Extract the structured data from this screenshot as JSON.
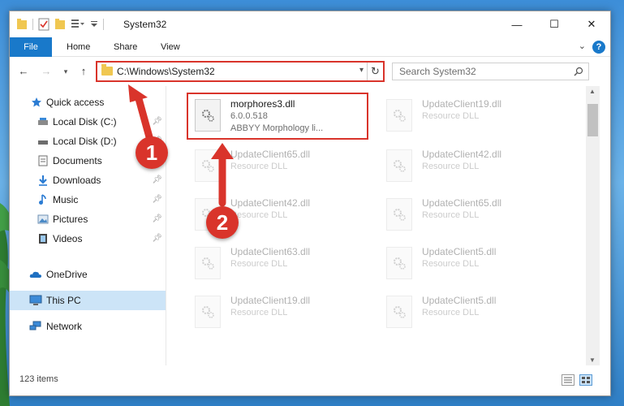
{
  "window": {
    "title": "System32",
    "controls": {
      "minimize": "—",
      "maximize": "☐",
      "close": "✕"
    }
  },
  "ribbon": {
    "tabs": [
      "File",
      "Home",
      "Share",
      "View"
    ],
    "help": "?"
  },
  "navigation": {
    "address": "C:\\Windows\\System32",
    "search_placeholder": "Search System32"
  },
  "sidebar": {
    "items": [
      {
        "label": "Quick access",
        "icon": "star-icon",
        "pinned": false
      },
      {
        "label": "Local Disk (C:)",
        "icon": "drive-icon",
        "pinned": true
      },
      {
        "label": "Local Disk (D:)",
        "icon": "drive-icon",
        "pinned": true
      },
      {
        "label": "Documents",
        "icon": "documents-icon",
        "pinned": true
      },
      {
        "label": "Downloads",
        "icon": "download-icon",
        "pinned": true
      },
      {
        "label": "Music",
        "icon": "music-icon",
        "pinned": true
      },
      {
        "label": "Pictures",
        "icon": "pictures-icon",
        "pinned": true
      },
      {
        "label": "Videos",
        "icon": "videos-icon",
        "pinned": true
      },
      {
        "label": "OneDrive",
        "icon": "cloud-icon",
        "pinned": false
      },
      {
        "label": "This PC",
        "icon": "computer-icon",
        "pinned": false
      },
      {
        "label": "Network",
        "icon": "network-icon",
        "pinned": false
      }
    ]
  },
  "files": [
    {
      "name": "morphores3.dll",
      "line2": "6.0.0.518",
      "line3": "ABBYY Morphology li...",
      "highlighted": true
    },
    {
      "name": "UpdateClient19.dll",
      "line2": "Resource DLL",
      "line3": ""
    },
    {
      "name": "UpdateClient65.dll",
      "line2": "Resource DLL",
      "line3": ""
    },
    {
      "name": "UpdateClient42.dll",
      "line2": "Resource DLL",
      "line3": ""
    },
    {
      "name": "UpdateClient42.dll",
      "line2": "Resource DLL",
      "line3": ""
    },
    {
      "name": "UpdateClient65.dll",
      "line2": "Resource DLL",
      "line3": ""
    },
    {
      "name": "UpdateClient63.dll",
      "line2": "Resource DLL",
      "line3": ""
    },
    {
      "name": "UpdateClient5.dll",
      "line2": "Resource DLL",
      "line3": ""
    },
    {
      "name": "UpdateClient19.dll",
      "line2": "Resource DLL",
      "line3": ""
    },
    {
      "name": "UpdateClient5.dll",
      "line2": "Resource DLL",
      "line3": ""
    }
  ],
  "status": {
    "item_count": "123 items"
  },
  "annotations": {
    "step1": "1",
    "step2": "2",
    "color": "#d9342b"
  }
}
